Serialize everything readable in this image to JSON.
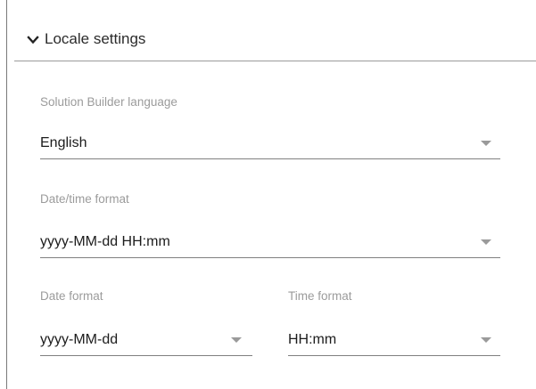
{
  "section": {
    "title": "Locale settings",
    "expanded": true,
    "chevron_icon": "chevron-down-icon"
  },
  "fields": {
    "language": {
      "label": "Solution Builder language",
      "value": "English"
    },
    "datetime_format": {
      "label": "Date/time format",
      "value": "yyyy-MM-dd HH:mm"
    },
    "date_format": {
      "label": "Date format",
      "value": "yyyy-MM-dd"
    },
    "time_format": {
      "label": "Time format",
      "value": "HH:mm"
    }
  },
  "icons": {
    "dropdown_arrow": "caret-down-icon"
  }
}
